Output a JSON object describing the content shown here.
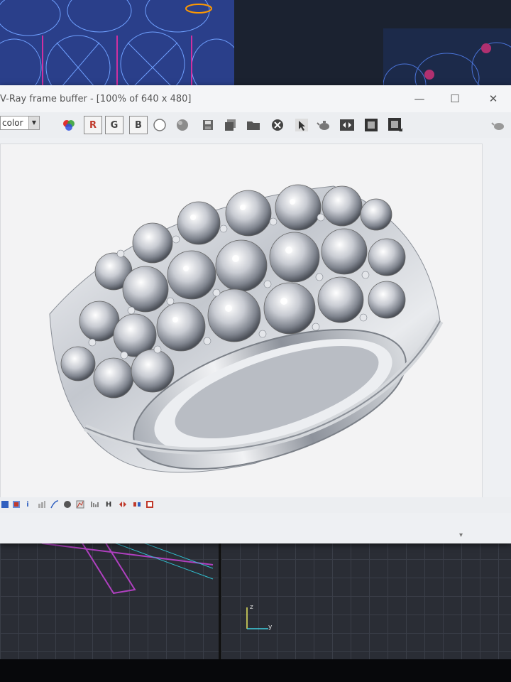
{
  "window": {
    "title": "V-Ray frame buffer - [100% of 640 x 480]",
    "minimize": "—",
    "maximize": "☐",
    "close": "✕"
  },
  "toolbar": {
    "channel": "color",
    "channel_arrow": "▼",
    "r_label": "R",
    "g_label": "G",
    "b_label": "B"
  },
  "statusbar": {
    "info_label": "i",
    "h_label": "H"
  },
  "gizmo": {
    "z_label": "z",
    "y_label": "y"
  },
  "colors": {
    "r_channel": "#c0392b",
    "g_channel": "#2e7d32",
    "b_channel": "#1f4fa0",
    "cad_wireframe": "#3d6cf0",
    "cad_magenta": "#d030a0"
  }
}
